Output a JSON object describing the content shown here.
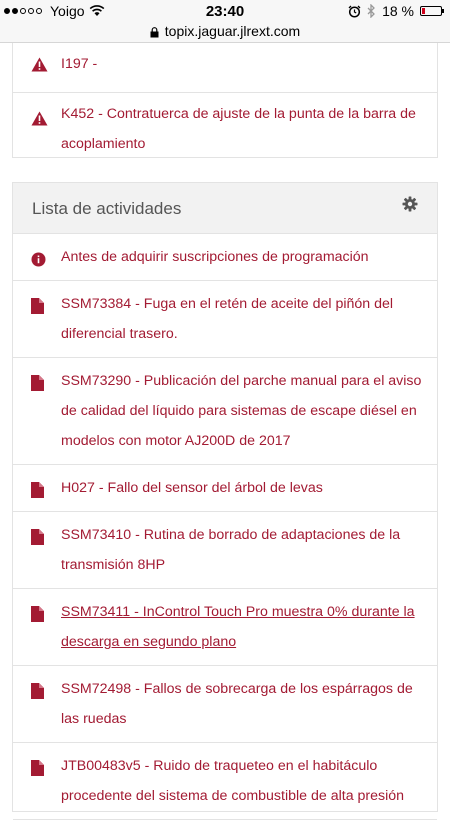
{
  "status_bar": {
    "carrier": "Yoigo",
    "time": "23:40",
    "battery_text": "18 %",
    "battery_level": 0.18,
    "signal_dots_filled": 2,
    "signal_dots_total": 5
  },
  "browser": {
    "url": "topix.jaguar.jlrext.com"
  },
  "alerts": [
    {
      "code": "I197 -",
      "icon": "warning-icon"
    },
    {
      "code": "K452 - Contratuerca de ajuste de la punta de la barra de acoplamiento",
      "icon": "warning-icon"
    }
  ],
  "activities": {
    "title": "Lista de actividades",
    "items": [
      {
        "label": "Antes de adquirir suscripciones de programación",
        "icon": "info-icon"
      },
      {
        "label": "SSM73384 - Fuga en el retén de aceite del piñón del diferencial trasero.",
        "icon": "document-icon"
      },
      {
        "label": "SSM73290 - Publicación del parche manual para el aviso de calidad del líquido para sistemas de escape diésel en modelos con motor AJ200D de 2017",
        "icon": "document-icon"
      },
      {
        "label": "H027 - Fallo del sensor del árbol de levas",
        "icon": "document-icon"
      },
      {
        "label": "SSM73410 - Rutina de borrado de adaptaciones de la transmisión 8HP",
        "icon": "document-icon"
      },
      {
        "label": "SSM73411 - InControl Touch Pro muestra 0% durante la descarga en segundo plano",
        "icon": "document-icon"
      },
      {
        "label": "SSM72498 - Fallos de sobrecarga de los espárragos de las ruedas",
        "icon": "document-icon"
      },
      {
        "label": "JTB00483v5 - Ruido de traqueteo en el habitáculo procedente del sistema de combustible de alta presión",
        "icon": "document-icon"
      }
    ]
  },
  "colors": {
    "accent": "#a31b33",
    "header_bg": "#f2f2f2",
    "border": "#e3e3e3"
  }
}
